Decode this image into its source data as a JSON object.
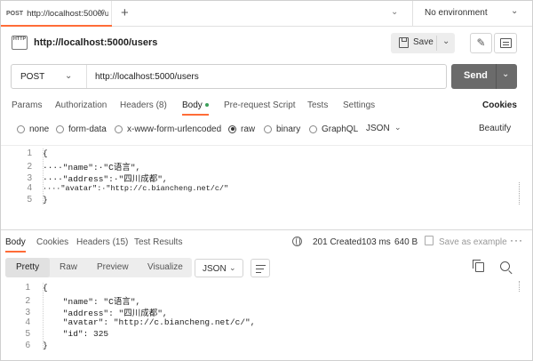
{
  "tab": {
    "method": "POST",
    "url": "http://localhost:5000/u",
    "close": "✕"
  },
  "plus": "+",
  "environment": {
    "label": "No environment"
  },
  "request": {
    "icon_text": "HTTP",
    "title": "http://localhost:5000/users",
    "save_label": "Save",
    "method": "POST",
    "url": "http://localhost:5000/users",
    "send_label": "Send"
  },
  "request_tabs": [
    {
      "label": "Params"
    },
    {
      "label": "Authorization"
    },
    {
      "label": "Headers (8)"
    },
    {
      "label": "Body"
    },
    {
      "label": "Pre-request Script"
    },
    {
      "label": "Tests"
    },
    {
      "label": "Settings"
    }
  ],
  "cookies_label": "Cookies",
  "body_types": [
    {
      "label": "none",
      "selected": false
    },
    {
      "label": "form-data",
      "selected": false
    },
    {
      "label": "x-www-form-urlencoded",
      "selected": false
    },
    {
      "label": "raw",
      "selected": true
    },
    {
      "label": "binary",
      "selected": false
    },
    {
      "label": "GraphQL",
      "selected": false
    }
  ],
  "raw_format": "JSON",
  "beautify_label": "Beautify",
  "request_body_lines": [
    {
      "num": "1",
      "text": "{"
    },
    {
      "num": "2",
      "text": "····\"name\":·\"C语言\","
    },
    {
      "num": "3",
      "text": "····\"address\":·\"四川成都\","
    },
    {
      "num": "4",
      "text": "····\"avatar\":·\"http://c.biancheng.net/c/\""
    },
    {
      "num": "5",
      "text": "}"
    }
  ],
  "response": {
    "tabs": [
      {
        "label": "Body"
      },
      {
        "label": "Cookies"
      },
      {
        "label": "Headers (15)"
      },
      {
        "label": "Test Results"
      }
    ],
    "status": "201 Created",
    "time": "103 ms",
    "size": "640 B",
    "save_example": "Save as example",
    "more": "···",
    "view_modes": [
      {
        "label": "Pretty"
      },
      {
        "label": "Raw"
      },
      {
        "label": "Preview"
      },
      {
        "label": "Visualize"
      }
    ],
    "format": "JSON",
    "body_lines": [
      {
        "num": "1",
        "text": "{"
      },
      {
        "num": "2",
        "text": "    \"name\": \"C语言\","
      },
      {
        "num": "3",
        "text": "    \"address\": \"四川成都\","
      },
      {
        "num": "4",
        "text": "    \"avatar\": \"http://c.biancheng.net/c/\","
      },
      {
        "num": "5",
        "text": "    \"id\": 325"
      },
      {
        "num": "6",
        "text": "}"
      }
    ]
  },
  "colors": {
    "accent": "#ff6c37",
    "send_bg": "#6b6b6b",
    "body_dot": "#3c9f5a"
  }
}
